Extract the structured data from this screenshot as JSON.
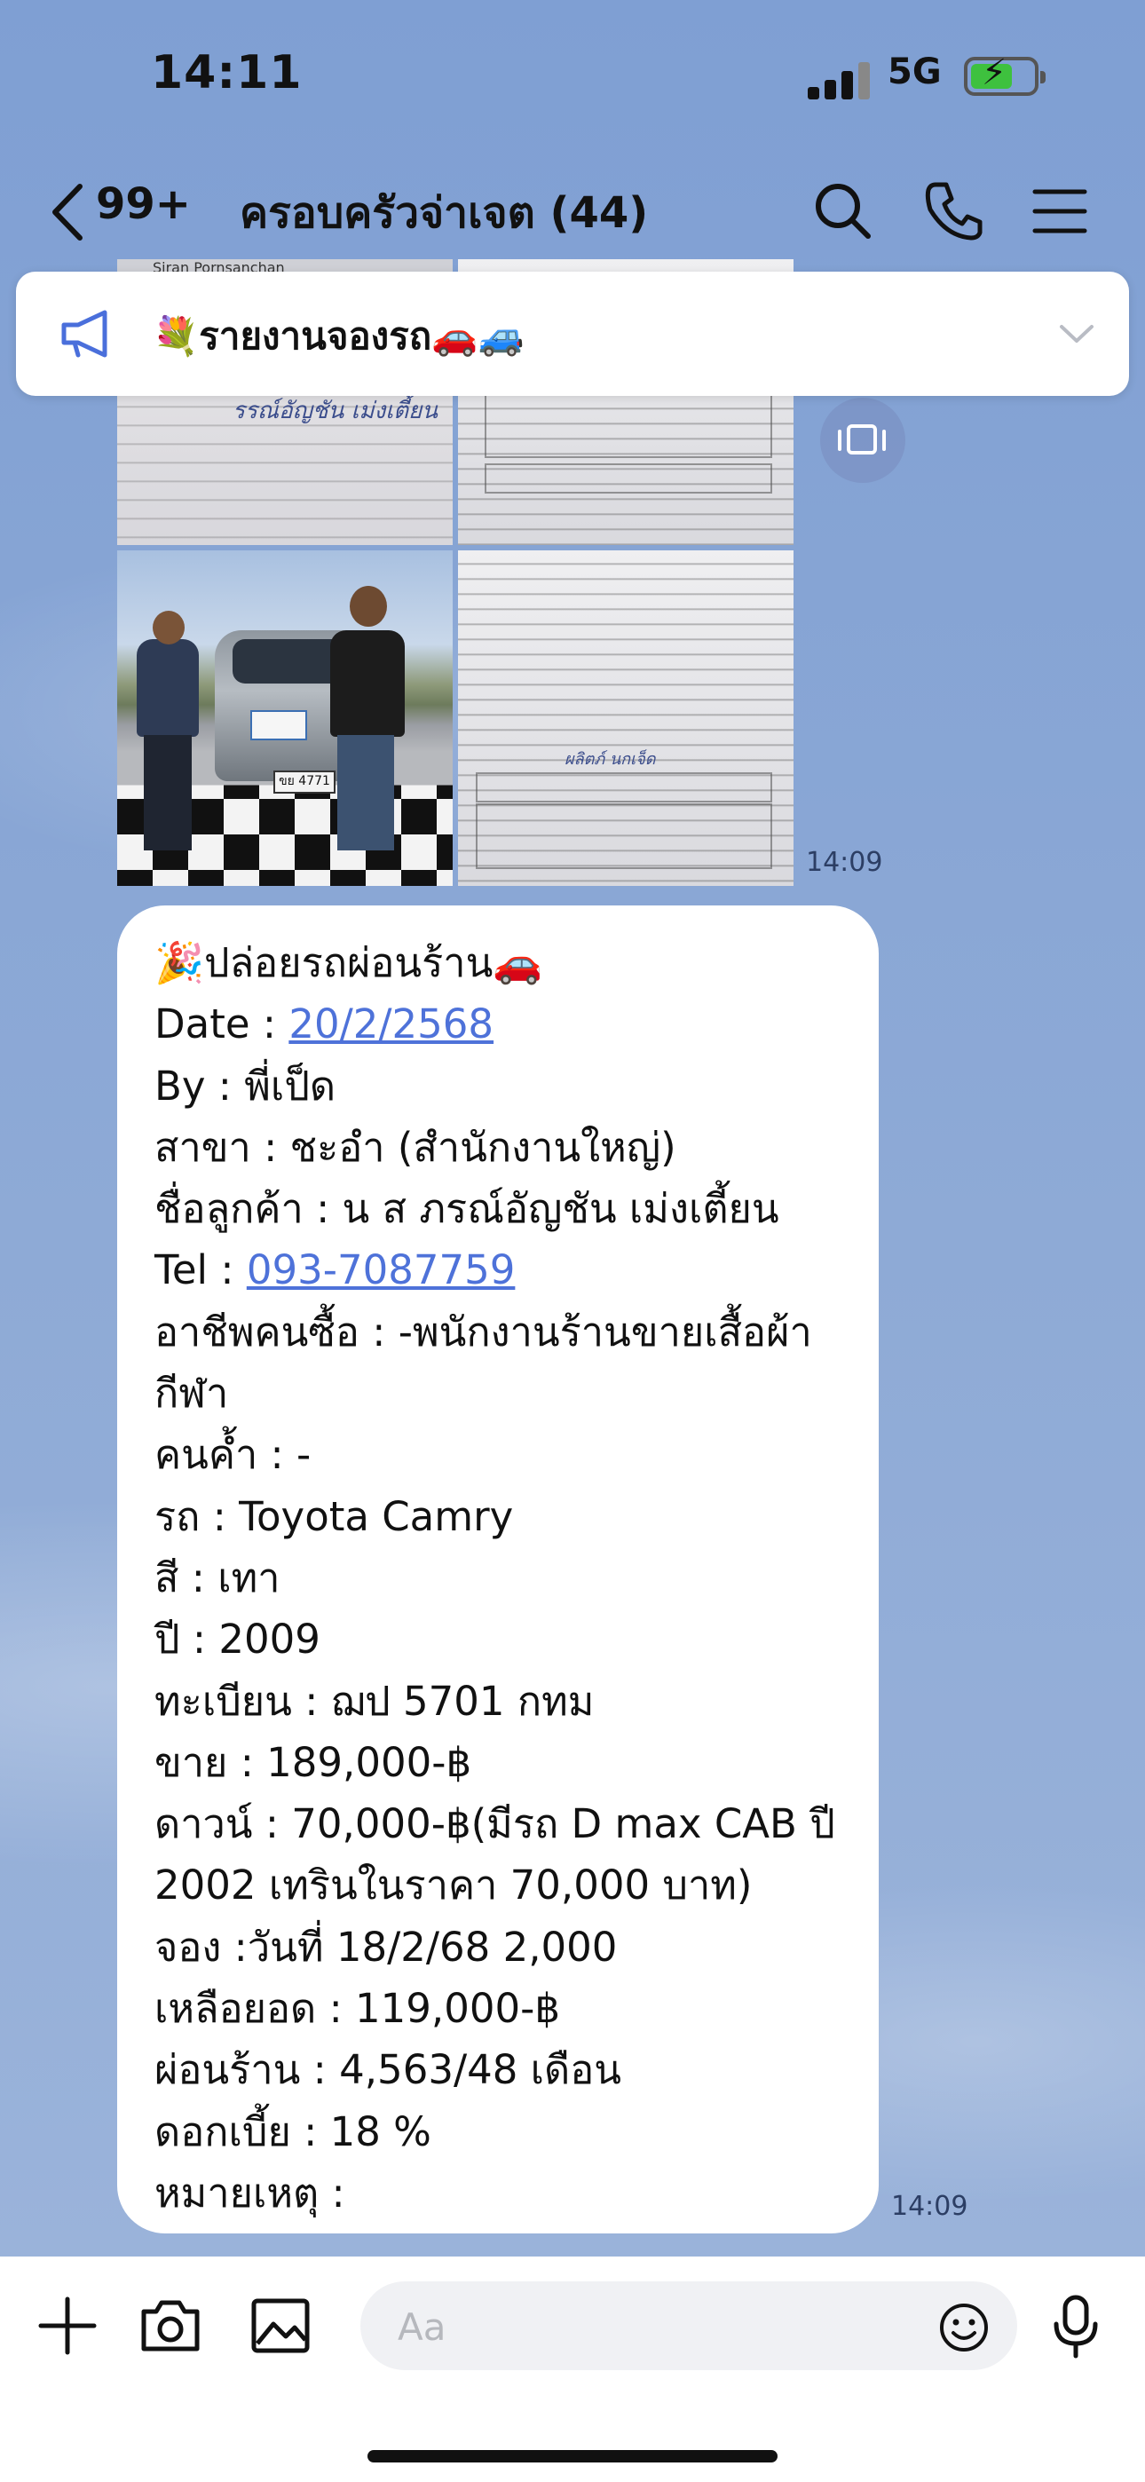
{
  "status_bar": {
    "time": "14:11",
    "network": "5G",
    "battery_color": "#3ec13e"
  },
  "header": {
    "unread_count": "99+",
    "room_title": "ครอบครัวจ่าเจต (44)",
    "icons": [
      "back-icon",
      "search-icon",
      "phone-icon",
      "menu-icon"
    ]
  },
  "announcement": {
    "icon": "megaphone-icon",
    "text": "💐รายงานจองรถ🚗🚙"
  },
  "photos": {
    "image_names": [
      "signed-document-photo",
      "form-document-photo",
      "car-handover-photo",
      "contract-document-photo"
    ],
    "doc1_handwriting": "รรณ์อัญชัน เม่งเตี้ยน",
    "doc1_header_name": "Siran Pornsanchan",
    "plate_text": "ขย 4771",
    "contract_signature": "ผลิตภ์ นกเจ็ด",
    "timestamp": "14:09"
  },
  "message": {
    "lines": [
      "🎉ปล่อยรถผ่อนร้าน🚗",
      {
        "label": "Date : ",
        "value": "20/2/2568"
      },
      "By : พี่เป็ด",
      "สาขา : ชะอำ (สำนักงานใหญ่)",
      "ชื่อลูกค้า : น ส ภรณ์อัญชัน เม่งเตี้ยน",
      {
        "label": "Tel : ",
        "value": "093-7087759"
      },
      "อาชีพคนซื้อ : -พนักงานร้านขายเสื้อผ้า",
      "กีฬา",
      "คนค้ำ : -",
      "รถ : Toyota Camry",
      "สี : เทา",
      "ปี : 2009",
      "ทะเบียน : ฌป 5701 กทม",
      "ขาย : 189,000-฿",
      "ดาวน์ : 70,000-฿(มีรถ D max CAB ปี",
      "2002 เทรินในราคา 70,000 บาท)",
      "จอง :วันที่ 18/2/68  2,000",
      "เหลือยอด : 119,000-฿",
      "ผ่อนร้าน : 4,563/48 เดือน",
      "ดอกเบี้ย : 18 %",
      "หมายเหตุ :"
    ],
    "timestamp": "14:09",
    "link_color": "#4e72d9"
  },
  "input_bar": {
    "placeholder": "Aa",
    "icons": [
      "plus-icon",
      "camera-icon",
      "image-icon",
      "emoji-icon",
      "microphone-icon"
    ]
  }
}
